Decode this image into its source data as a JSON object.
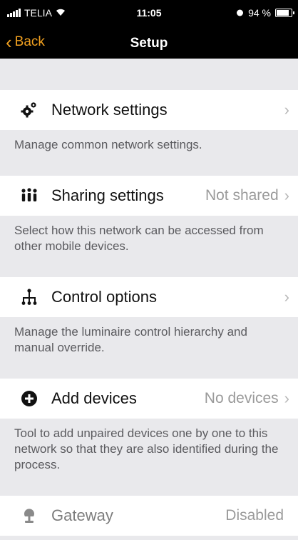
{
  "status_bar": {
    "carrier": "TELIA",
    "time": "11:05",
    "battery": "94 %",
    "battery_level": 0.94,
    "icons": [
      "signal-icon",
      "wifi-icon",
      "alarm-icon",
      "battery-icon"
    ]
  },
  "nav": {
    "back_label": "Back",
    "title": "Setup"
  },
  "accent_color": "#f0a020",
  "sections": [
    {
      "key": "network",
      "title": "Network settings",
      "value": "",
      "icon": "gears-icon",
      "desc": "Manage common network settings."
    },
    {
      "key": "sharing",
      "title": "Sharing settings",
      "value": "Not shared",
      "icon": "people-icon",
      "desc": "Select how this network can be accessed from other mobile devices."
    },
    {
      "key": "control",
      "title": "Control options",
      "value": "",
      "icon": "hierarchy-icon",
      "desc": "Manage the luminaire control hierarchy and manual override."
    },
    {
      "key": "add",
      "title": "Add devices",
      "value": "No devices",
      "icon": "plus-circle-icon",
      "desc": "Tool to add unpaired devices one by one to this network so that they are also identified during the process."
    },
    {
      "key": "gateway",
      "title": "Gateway",
      "value": "Disabled",
      "icon": "gateway-icon",
      "desc": ""
    }
  ]
}
